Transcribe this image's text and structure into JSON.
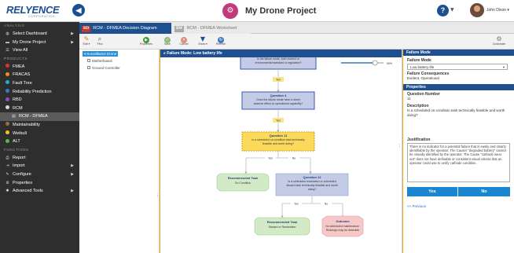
{
  "header": {
    "logo_text": "RELYENCE",
    "logo_sub": "CORPORATION",
    "collapse_glyph": "◀",
    "project_title": "My Drone Project",
    "help_glyph": "?",
    "user_name": "John Dixon ▾"
  },
  "sidebar": {
    "sections": {
      "analysis": "ANALYSIS",
      "products": "PRODUCTS",
      "functions": "FUNCTIONS"
    },
    "analysis_items": [
      {
        "label": "Select Dashboard",
        "icon": "dashboard-icon"
      },
      {
        "label": "My Drone Project",
        "icon": "folder-icon"
      },
      {
        "label": "View All",
        "icon": "list-icon"
      }
    ],
    "product_items": [
      {
        "label": "FMEA",
        "color": "#e0332c"
      },
      {
        "label": "FRACAS",
        "color": "#f28a1d"
      },
      {
        "label": "Fault Tree",
        "color": "#2aa9d4"
      },
      {
        "label": "Reliability Prediction",
        "color": "#2f7fd0"
      },
      {
        "label": "RBD",
        "color": "#8a4fc9"
      },
      {
        "label": "RCM",
        "color": "#d8d8d8"
      },
      {
        "label": "RCM - DFMEA",
        "icon": "document-icon"
      },
      {
        "label": "Maintainability",
        "color": "#9b6c3d"
      },
      {
        "label": "Weibull",
        "color": "#f2c21d"
      },
      {
        "label": "ALT",
        "color": "#57b947"
      }
    ],
    "function_items": [
      {
        "label": "Report",
        "icon": "print-icon"
      },
      {
        "label": "Import",
        "icon": "import-icon"
      },
      {
        "label": "Configure",
        "icon": "wrench-icon"
      },
      {
        "label": "Properties",
        "icon": "gear-icon"
      },
      {
        "label": "Advanced Tools",
        "icon": "tools-icon"
      }
    ]
  },
  "tabs": [
    {
      "badge": "RD",
      "label": "RCM - DFMEA Decision Diagram"
    },
    {
      "badge": "RW",
      "label": "RCM - DFMEA Worksheet"
    }
  ],
  "toolbar": {
    "edit_label": "Edit ▾",
    "find_label": "Find",
    "properties_label": "Properties",
    "save_label": "Save",
    "cancel_label": "Cancel",
    "show_label": "Show ▾",
    "refresh_label": "Refresh",
    "customize_label": "Customize"
  },
  "tree": {
    "root": "Surveillance Drone",
    "children": [
      "Motherboard",
      "Ground Controller"
    ]
  },
  "canvas": {
    "header": "Failure Mode: Low battery life",
    "zoom_value": "50%",
    "zoom_fraction": 0.8
  },
  "diagram": {
    "top_box_lines": [
      "Is the failure mode, both evident or",
      "environmental standard or regulation?"
    ],
    "q4_title": "Question 4",
    "q4_lines": [
      "Does the failure mode have a direct",
      "adverse effect on operational capability?"
    ],
    "q11_title": "Question 11",
    "q11_lines": [
      "Is a scheduled on-condition task technically",
      "feasible and worth doing?"
    ],
    "q12_title": "Question 12",
    "q12_lines": [
      "Is a scheduled restoration or scheduled",
      "discard task technically feasible and worth",
      "doing?"
    ],
    "rec1_title": "Recommended Task",
    "rec1_text": "On Condition",
    "rec2_title": "Recommended Task",
    "rec2_text": "Discard or Restoration",
    "outcome_title": "Outcome",
    "outcome_lines": [
      "No scheduled maintenance.",
      "Redesign may be desirable"
    ],
    "yes": "Yes",
    "no": "No"
  },
  "panel": {
    "header": "Failure Mode",
    "fm_label": "Failure Mode",
    "fm_value": "Low battery life",
    "consequences_label": "Failure Consequences",
    "consequences_value": "Evident, Operational",
    "properties_header": "Properties",
    "qnum_label": "Question Number",
    "qnum_value": "11",
    "desc_label": "Description",
    "desc_value": "Is a scheduled on-condition task technically feasible and worth doing?",
    "just_label": "Justification",
    "just_value": "There is no indicator for a potential failure that is easily and clearly identifiable by the operator. The Causer \"degraded battery\" cannot be visually identified by the operator. The Cause \"cathode wear out\" does not have definable or consistent visual criteria that an operator could use to verify cathode condition.",
    "yes_button": "Yes",
    "no_button": "No",
    "previous_link": "<< Previous"
  }
}
